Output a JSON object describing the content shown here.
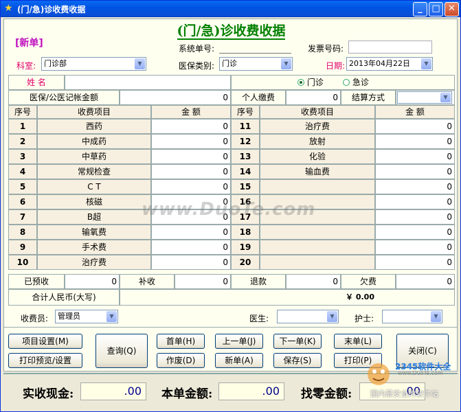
{
  "window": {
    "title": "(门/急)诊收费收据"
  },
  "form": {
    "caption": "(门/急)诊收费收据",
    "new_badge": "[新单]",
    "system_no_label": "系统单号:",
    "invoice_no_label": "发票号码:",
    "dept_label": "科室:",
    "dept_value": "门诊部",
    "insurance_label": "医保类别:",
    "insurance_value": "门诊",
    "date_label": "日期:",
    "date_value": "2013年04月22日",
    "name_label": "姓  名",
    "radio_outpatient": "门诊",
    "radio_emergency": "急诊",
    "insurance_amount_label": "医保/公医记帐金额",
    "insurance_amount_value": "0",
    "personal_pay_label": "个人缴费",
    "personal_pay_value": "0",
    "settlement_label": "结算方式",
    "headers": {
      "seq": "序号",
      "item": "收费项目",
      "amount": "金  额"
    },
    "left_rows": [
      {
        "seq": "1",
        "item": "西药",
        "amount": "0"
      },
      {
        "seq": "2",
        "item": "中成药",
        "amount": "0"
      },
      {
        "seq": "3",
        "item": "中草药",
        "amount": "0"
      },
      {
        "seq": "4",
        "item": "常规检查",
        "amount": "0"
      },
      {
        "seq": "5",
        "item": "C T",
        "amount": "0"
      },
      {
        "seq": "6",
        "item": "核磁",
        "amount": "0"
      },
      {
        "seq": "7",
        "item": "B超",
        "amount": "0"
      },
      {
        "seq": "8",
        "item": "输氧费",
        "amount": "0"
      },
      {
        "seq": "9",
        "item": "手术费",
        "amount": "0"
      },
      {
        "seq": "10",
        "item": "治疗费",
        "amount": "0"
      }
    ],
    "right_rows": [
      {
        "seq": "11",
        "item": "治疗费",
        "amount": "0"
      },
      {
        "seq": "12",
        "item": "放射",
        "amount": "0"
      },
      {
        "seq": "13",
        "item": "化验",
        "amount": "0"
      },
      {
        "seq": "14",
        "item": "输血费",
        "amount": "0"
      },
      {
        "seq": "15",
        "item": "",
        "amount": "0"
      },
      {
        "seq": "16",
        "item": "",
        "amount": "0"
      },
      {
        "seq": "17",
        "item": "",
        "amount": "0"
      },
      {
        "seq": "18",
        "item": "",
        "amount": "0"
      },
      {
        "seq": "19",
        "item": "",
        "amount": "0"
      },
      {
        "seq": "20",
        "item": "",
        "amount": "0"
      }
    ],
    "prepaid_label": "已预收",
    "prepaid_value": "0",
    "extra_label": "补收",
    "extra_value": "0",
    "refund_label": "退款",
    "refund_value": "0",
    "owed_label": "欠费",
    "owed_value": "0",
    "total_label": "合计人民币(大写)",
    "total_value": "￥ 0.00",
    "cashier_label": "收费员:",
    "cashier_value": "管理员",
    "doctor_label": "医生:",
    "nurse_label": "护士:"
  },
  "buttons": {
    "item_settings": "项目设置(M)",
    "print_preview": "打印预览/设置",
    "query": "查询(Q)",
    "first": "首单(H)",
    "void": "作废(D)",
    "prev": "上一单(J)",
    "new": "新单(A)",
    "next": "下一单(K)",
    "save": "保存(S)",
    "last": "末单(L)",
    "print": "打印(P)",
    "close": "关闭(C)"
  },
  "summary": {
    "cash_label": "实收现金:",
    "cash_value": ".00",
    "amount_label": "本单金额:",
    "amount_value": ".00",
    "change_label": "找零金额:",
    "change_value": ".00"
  },
  "overlay": {
    "watermark": "www.DuoTe.com",
    "brand_line1": "2345软件大全",
    "brand_line2": "国内最安全的软件站",
    "brand_url": "www.DuoTe.com"
  },
  "colors": {
    "accent_red": "#e0006a",
    "title_green": "#008000",
    "titlebar_blue": "#0054e3"
  }
}
